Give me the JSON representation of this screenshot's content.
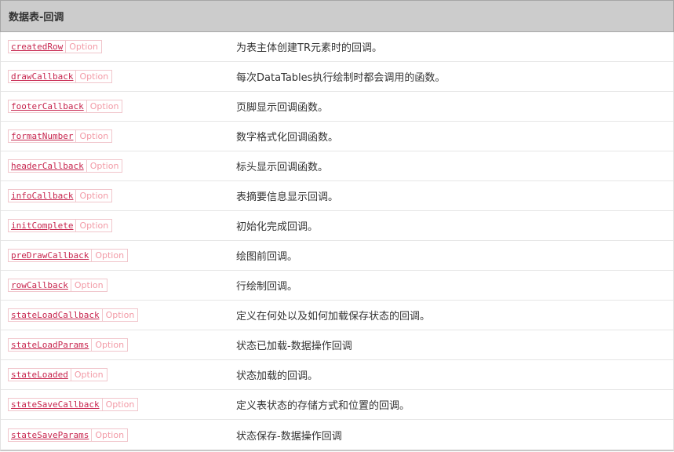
{
  "header": {
    "title": "数据表-回调"
  },
  "rows": [
    {
      "name": "createdRow",
      "type": "Option",
      "desc": "为表主体创建TR元素时的回调。"
    },
    {
      "name": "drawCallback",
      "type": "Option",
      "desc": "每次DataTables执行绘制时都会调用的函数。"
    },
    {
      "name": "footerCallback",
      "type": "Option",
      "desc": "页脚显示回调函数。"
    },
    {
      "name": "formatNumber",
      "type": "Option",
      "desc": "数字格式化回调函数。"
    },
    {
      "name": "headerCallback",
      "type": "Option",
      "desc": "标头显示回调函数。"
    },
    {
      "name": "infoCallback",
      "type": "Option",
      "desc": "表摘要信息显示回调。"
    },
    {
      "name": "initComplete",
      "type": "Option",
      "desc": "初始化完成回调。"
    },
    {
      "name": "preDrawCallback",
      "type": "Option",
      "desc": "绘图前回调。"
    },
    {
      "name": "rowCallback",
      "type": "Option",
      "desc": "行绘制回调。"
    },
    {
      "name": "stateLoadCallback",
      "type": "Option",
      "desc": "定义在何处以及如何加载保存状态的回调。"
    },
    {
      "name": "stateLoadParams",
      "type": "Option",
      "desc": "状态已加载-数据操作回调"
    },
    {
      "name": "stateLoaded",
      "type": "Option",
      "desc": "状态加载的回调。"
    },
    {
      "name": "stateSaveCallback",
      "type": "Option",
      "desc": "定义表状态的存储方式和位置的回调。"
    },
    {
      "name": "stateSaveParams",
      "type": "Option",
      "desc": "状态保存-数据操作回调"
    }
  ]
}
